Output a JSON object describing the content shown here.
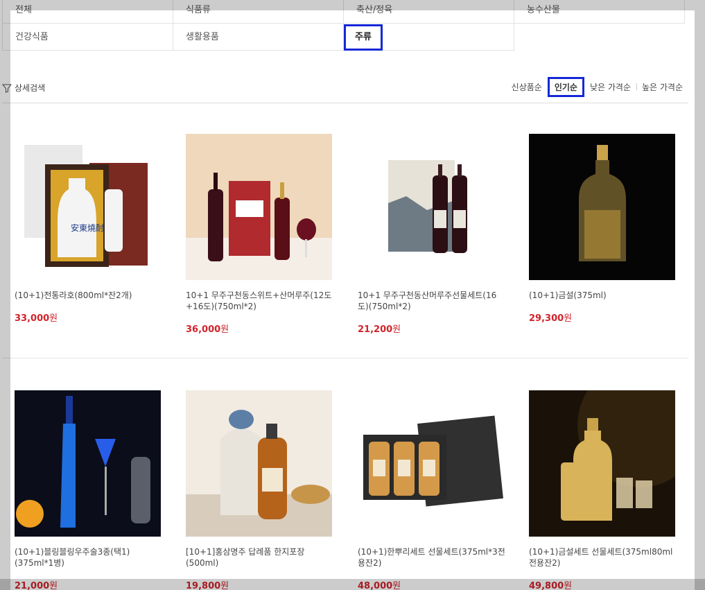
{
  "categories": [
    [
      "전체",
      "식품류",
      "축산/정육",
      "농수산물"
    ],
    [
      "건강식품",
      "생활용품",
      "주류"
    ]
  ],
  "filter_label": "상세검색",
  "sort_options": [
    "신상품순",
    "인기순",
    "낮은 가격순",
    "높은 가격순"
  ],
  "products": [
    {
      "name": "(10+1)전통라호(800ml*잔2개)",
      "price": "33,000",
      "unit": "원"
    },
    {
      "name": "10+1 무주구천동스위트+산머루주(12도+16도)(750ml*2)",
      "price": "36,000",
      "unit": "원"
    },
    {
      "name": "10+1 무주구천동산머루주선물세트(16도)(750ml*2)",
      "price": "21,200",
      "unit": "원"
    },
    {
      "name": "(10+1)금설(375ml)",
      "price": "29,300",
      "unit": "원"
    },
    {
      "name": "(10+1)블링블링우주술3종(택1)(375ml*1병)",
      "price": "21,000",
      "unit": "원"
    },
    {
      "name": "[10+1]홍삼명주 답례품 한지포장(500ml)",
      "price": "19,800",
      "unit": "원"
    },
    {
      "name": "(10+1)한뿌리세트 선물세트(375ml*3전용잔2)",
      "price": "48,000",
      "unit": "원"
    },
    {
      "name": "(10+1)금설세트 선물세트(375ml80ml전용잔2)",
      "price": "49,800",
      "unit": "원"
    }
  ],
  "colors": {
    "price": "#d0242b",
    "highlight": "#1428d8"
  }
}
